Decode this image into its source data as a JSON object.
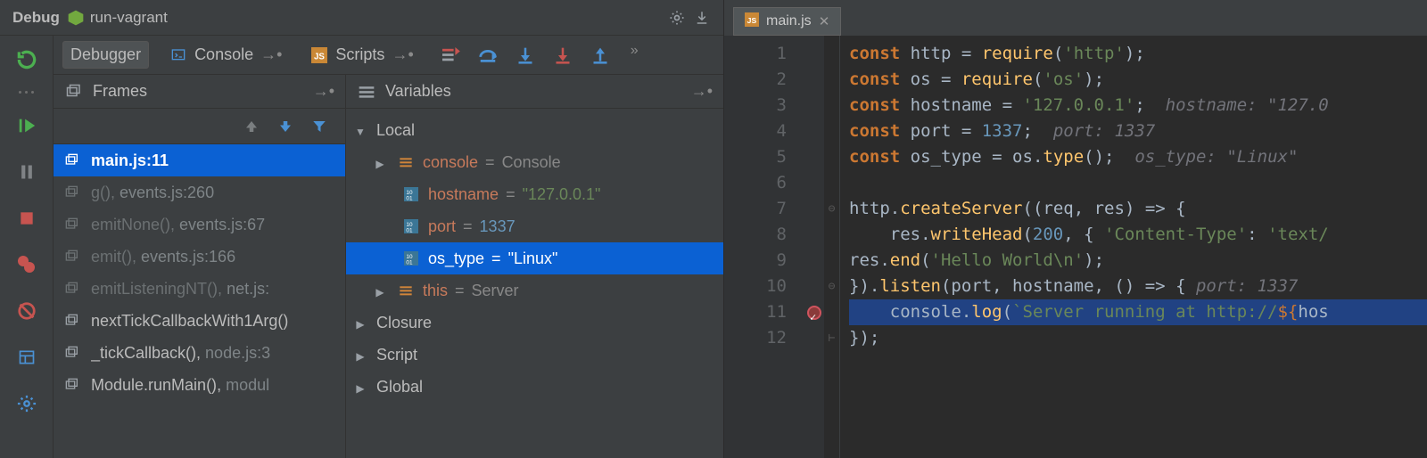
{
  "header": {
    "title": "Debug",
    "run_config": "run-vagrant"
  },
  "tabs": {
    "debugger": "Debugger",
    "console": "Console",
    "scripts": "Scripts"
  },
  "panes": {
    "frames_title": "Frames",
    "variables_title": "Variables"
  },
  "frames": [
    {
      "label": "main.js:11",
      "sel": true,
      "dim": false
    },
    {
      "fn": "g()",
      "loc": "events.js:260",
      "dim": true
    },
    {
      "fn": "emitNone()",
      "loc": "events.js:67",
      "dim": true
    },
    {
      "fn": "emit()",
      "loc": "events.js:166",
      "dim": true
    },
    {
      "fn": "emitListeningNT()",
      "loc": "net.js:",
      "dim": true
    },
    {
      "fn": "nextTickCallbackWith1Arg()",
      "loc": "",
      "dim": false
    },
    {
      "fn": "_tickCallback()",
      "loc": "node.js:3",
      "dim": false
    },
    {
      "fn": "Module.runMain()",
      "loc": "modul",
      "dim": false
    }
  ],
  "variables": {
    "scope_local": "Local",
    "scope_closure": "Closure",
    "scope_script": "Script",
    "scope_global": "Global",
    "items": {
      "console": {
        "name": "console",
        "val": "Console"
      },
      "hostname": {
        "name": "hostname",
        "val": "\"127.0.0.1\""
      },
      "port": {
        "name": "port",
        "val": "1337"
      },
      "os_type": {
        "name": "os_type",
        "val": "\"Linux\""
      },
      "this": {
        "name": "this",
        "val": "Server"
      }
    }
  },
  "editor": {
    "tab_name": "main.js",
    "lines": [
      "1",
      "2",
      "3",
      "4",
      "5",
      "6",
      "7",
      "8",
      "9",
      "10",
      "11",
      "12"
    ],
    "code": {
      "l1": {
        "kw": "const ",
        "id": "http ",
        "eq": "= ",
        "fn": "require",
        "p1": "(",
        "s": "'http'",
        "p2": ");"
      },
      "l2": {
        "kw": "const ",
        "id": "os ",
        "eq": "= ",
        "fn": "require",
        "p1": "(",
        "s": "'os'",
        "p2": ");"
      },
      "l3": {
        "kw": "const ",
        "id": "hostname ",
        "eq": "= ",
        "s": "'127.0.0.1'",
        "p2": ";",
        "hint": "  hostname: \"127.0"
      },
      "l4": {
        "kw": "const ",
        "id": "port ",
        "eq": "= ",
        "n": "1337",
        "p2": ";",
        "hint": "  port: 1337"
      },
      "l5": {
        "kw": "const ",
        "id": "os_type ",
        "eq": "= ",
        "o": "os",
        "d": ".",
        "m": "type",
        "p": "();",
        "hint": "  os_type: \"Linux\""
      },
      "l7": "http.createServer((req, res) => {",
      "l8_a": "    res.",
      "l8_b": "writeHead",
      "l8_c": "(",
      "l8_d": "200",
      "l8_e": ", { ",
      "l8_f": "'Content-Type'",
      "l8_g": ": ",
      "l8_h": "'text/",
      "l9_a": "res.",
      "l9_b": "end",
      "l9_c": "(",
      "l9_d": "'Hello World\\n'",
      "l9_e": ");",
      "l10_a": "}).",
      "l10_b": "listen",
      "l10_c": "(port, hostname, () => {",
      "l10_hint": " port: 1337",
      "l11_a": "    console.",
      "l11_b": "log",
      "l11_c": "(",
      "l11_d": "`Server running at http://",
      "l11_e": "${",
      "l11_f": "hos",
      "l12": "});"
    }
  }
}
